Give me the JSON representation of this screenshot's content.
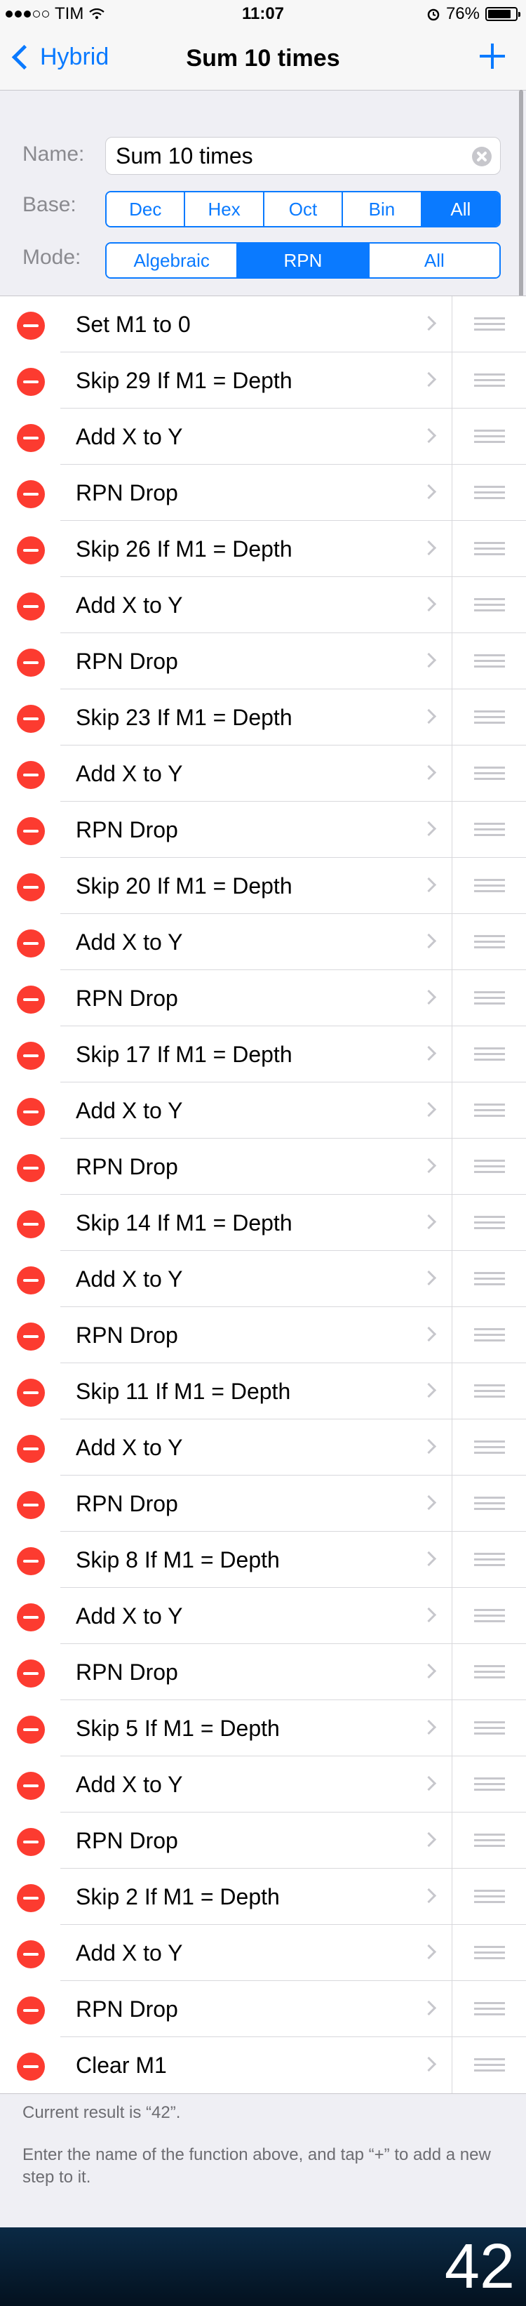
{
  "status": {
    "carrier": "TIM",
    "time": "11:07",
    "battery": "76%"
  },
  "nav": {
    "back_label": "Hybrid",
    "title": "Sum 10 times"
  },
  "form": {
    "name_label": "Name:",
    "name_value": "Sum 10 times",
    "base_label": "Base:",
    "base_options": [
      "Dec",
      "Hex",
      "Oct",
      "Bin",
      "All"
    ],
    "base_selected": "All",
    "mode_label": "Mode:",
    "mode_options": [
      "Algebraic",
      "RPN",
      "All"
    ],
    "mode_selected": "RPN"
  },
  "steps": [
    "Set M1 to 0",
    "Skip 29 If M1 = Depth",
    "Add X to Y",
    "RPN Drop",
    "Skip 26 If M1 = Depth",
    "Add X to Y",
    "RPN Drop",
    "Skip 23 If M1 = Depth",
    "Add X to Y",
    "RPN Drop",
    "Skip 20 If M1 = Depth",
    "Add X to Y",
    "RPN Drop",
    "Skip 17 If M1 = Depth",
    "Add X to Y",
    "RPN Drop",
    "Skip 14 If M1 = Depth",
    "Add X to Y",
    "RPN Drop",
    "Skip 11 If M1 = Depth",
    "Add X to Y",
    "RPN Drop",
    "Skip 8 If M1 = Depth",
    "Add X to Y",
    "RPN Drop",
    "Skip 5 If M1 = Depth",
    "Add X to Y",
    "RPN Drop",
    "Skip 2 If M1 = Depth",
    "Add X to Y",
    "RPN Drop",
    "Clear M1"
  ],
  "footer": {
    "result_text": "Current result is “42”.",
    "help_text": "Enter the name of the function above, and tap “+” to add a new step to it."
  },
  "result_display": "42",
  "colors": {
    "accent": "#0a7aff",
    "delete": "#fc3b30",
    "result_bar": "#0b2a45"
  }
}
